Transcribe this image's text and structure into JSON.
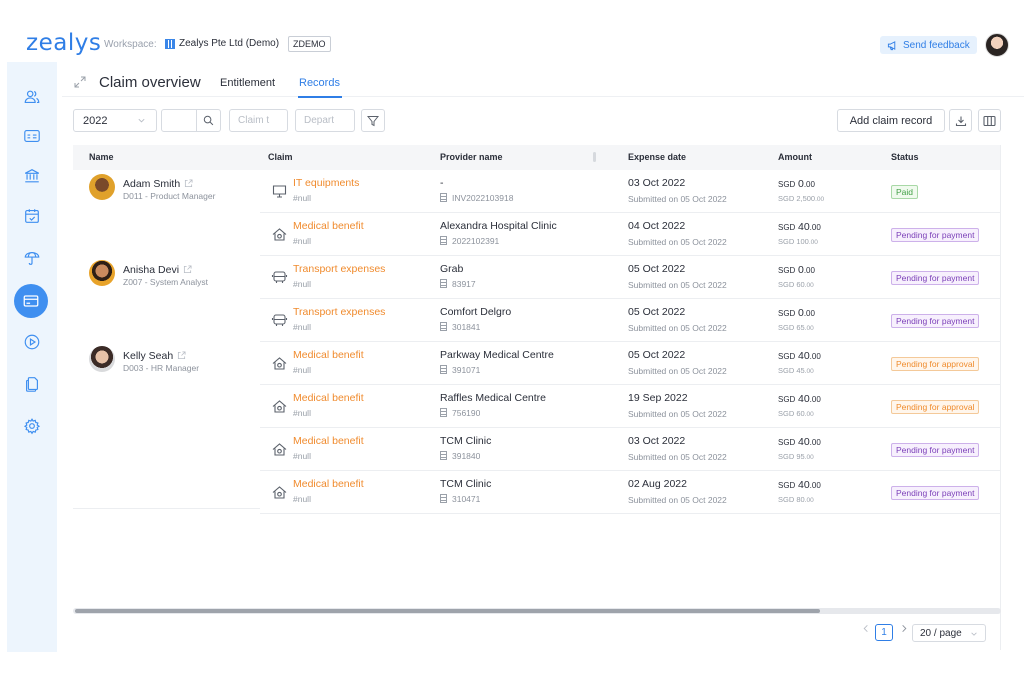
{
  "app": {
    "logo": "zealys",
    "workspace_label": "Workspace:",
    "workspace_name": "Zealys Pte Ltd (Demo)",
    "workspace_code": "ZDEMO",
    "feedback_label": "Send feedback"
  },
  "sidebar": {
    "items": [
      "users-icon",
      "id-card-icon",
      "bank-icon",
      "calendar-check-icon",
      "umbrella-icon",
      "card-icon",
      "play-circle-icon",
      "documents-icon",
      "settings-icon"
    ],
    "active": "card-icon",
    "accent": "#3f8ff0"
  },
  "header": {
    "title": "Claim overview",
    "tabs": [
      {
        "label": "Entitlement",
        "active": false
      },
      {
        "label": "Records",
        "active": true
      }
    ]
  },
  "filters": {
    "year": "2022",
    "claim_type_placeholder": "Claim t",
    "department_placeholder": "Depart"
  },
  "actions": {
    "add_label": "Add claim record"
  },
  "table": {
    "headers": [
      "Name",
      "Claim",
      "Provider name",
      "Expense date",
      "Amount",
      "Status"
    ],
    "people": [
      {
        "name": "Adam Smith",
        "role": "D011 - Product Manager"
      },
      {
        "name": "Anisha Devi",
        "role": "Z007 - System Analyst"
      },
      {
        "name": "Kelly Seah",
        "role": "D003 - HR Manager"
      }
    ],
    "rows": [
      {
        "icon": "monitor-icon",
        "claim": "IT equipments",
        "sub": "#null",
        "provider": "-",
        "ref": "INV2022103918",
        "date": "03 Oct 2022",
        "submitted": "Submitted on 05 Oct 2022",
        "currency": "SGD",
        "amount": "0",
        "amount_dec": ".00",
        "orig": "SGD 2,500",
        "orig_dec": ".00",
        "status": "Paid",
        "status_type": "paid"
      },
      {
        "icon": "house-medical-icon",
        "claim": "Medical benefit",
        "sub": "#null",
        "provider": "Alexandra Hospital Clinic",
        "ref": "2022102391",
        "date": "04 Oct 2022",
        "submitted": "Submitted on 05 Oct 2022",
        "currency": "SGD",
        "amount": "40",
        "amount_dec": ".00",
        "orig": "SGD 100",
        "orig_dec": ".00",
        "status": "Pending for payment",
        "status_type": "pay"
      },
      {
        "icon": "bus-icon",
        "claim": "Transport expenses",
        "sub": "#null",
        "provider": "Grab",
        "ref": "83917",
        "date": "05 Oct 2022",
        "submitted": "Submitted on 05 Oct 2022",
        "currency": "SGD",
        "amount": "0",
        "amount_dec": ".00",
        "orig": "SGD 60",
        "orig_dec": ".00",
        "status": "Pending for payment",
        "status_type": "pay"
      },
      {
        "icon": "bus-icon",
        "claim": "Transport expenses",
        "sub": "#null",
        "provider": "Comfort Delgro",
        "ref": "301841",
        "date": "05 Oct 2022",
        "submitted": "Submitted on 05 Oct 2022",
        "currency": "SGD",
        "amount": "0",
        "amount_dec": ".00",
        "orig": "SGD 65",
        "orig_dec": ".00",
        "status": "Pending for payment",
        "status_type": "pay"
      },
      {
        "icon": "house-medical-icon",
        "claim": "Medical benefit",
        "sub": "#null",
        "provider": "Parkway Medical Centre",
        "ref": "391071",
        "date": "05 Oct 2022",
        "submitted": "Submitted on 05 Oct 2022",
        "currency": "SGD",
        "amount": "40",
        "amount_dec": ".00",
        "orig": "SGD 45",
        "orig_dec": ".00",
        "status": "Pending for approval",
        "status_type": "appr"
      },
      {
        "icon": "house-medical-icon",
        "claim": "Medical benefit",
        "sub": "#null",
        "provider": "Raffles Medical Centre",
        "ref": "756190",
        "date": "19 Sep 2022",
        "submitted": "Submitted on 05 Oct 2022",
        "currency": "SGD",
        "amount": "40",
        "amount_dec": ".00",
        "orig": "SGD 60",
        "orig_dec": ".00",
        "status": "Pending for approval",
        "status_type": "appr"
      },
      {
        "icon": "house-medical-icon",
        "claim": "Medical benefit",
        "sub": "#null",
        "provider": "TCM Clinic",
        "ref": "391840",
        "date": "03 Oct 2022",
        "submitted": "Submitted on 05 Oct 2022",
        "currency": "SGD",
        "amount": "40",
        "amount_dec": ".00",
        "orig": "SGD 95",
        "orig_dec": ".00",
        "status": "Pending for payment",
        "status_type": "pay"
      },
      {
        "icon": "house-medical-icon",
        "claim": "Medical benefit",
        "sub": "#null",
        "provider": "TCM Clinic",
        "ref": "310471",
        "date": "02 Aug 2022",
        "submitted": "Submitted on 05 Oct 2022",
        "currency": "SGD",
        "amount": "40",
        "amount_dec": ".00",
        "orig": "SGD 80",
        "orig_dec": ".00",
        "status": "Pending for payment",
        "status_type": "pay"
      }
    ]
  },
  "pagination": {
    "current": "1",
    "page_size": "20 / page"
  },
  "colors": {
    "brand": "#2f7ee6",
    "claim": "#f08b2e",
    "paid": "#43a047",
    "pending_payment": "#7b3fb8",
    "pending_approval": "#ef8b2c"
  }
}
